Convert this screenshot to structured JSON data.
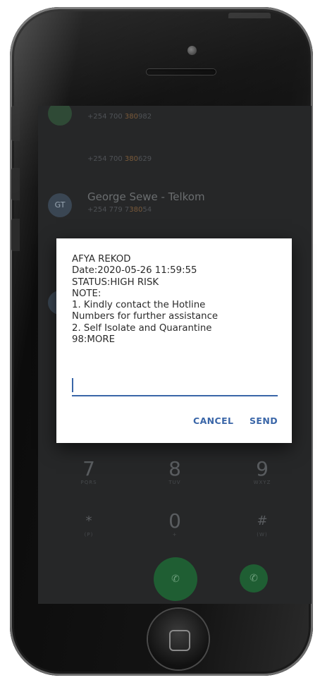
{
  "contacts": [
    {
      "initials": "",
      "name": "",
      "number_prefix": "+254 700 ",
      "number_highlight": "380",
      "number_suffix": "982"
    },
    {
      "initials": "",
      "name": "",
      "number_prefix": "+254 700 ",
      "number_highlight": "380",
      "number_suffix": "629"
    },
    {
      "initials": "GT",
      "name": "George Sewe - Telkom",
      "number_prefix": "+254 779 7",
      "number_highlight": "380",
      "number_suffix": "54"
    }
  ],
  "ussd_dialog": {
    "lines": [
      "AFYA REKOD",
      "Date:2020-05-26 11:59:55",
      "STATUS:HIGH RISK",
      "NOTE:",
      "1. Kindly contact the Hotline",
      "Numbers for further assistance",
      "2. Self Isolate and Quarantine",
      "98:MORE"
    ],
    "input_value": "",
    "cancel_label": "CANCEL",
    "send_label": "SEND"
  },
  "dialpad": {
    "keys": [
      {
        "digit": "7",
        "letters": "PQRS"
      },
      {
        "digit": "8",
        "letters": "TUV"
      },
      {
        "digit": "9",
        "letters": "WXYZ"
      },
      {
        "digit": "*",
        "letters": "(P)"
      },
      {
        "digit": "0",
        "letters": "+"
      },
      {
        "digit": "#",
        "letters": "(W)"
      }
    ]
  },
  "colors": {
    "accent": "#3a66a8",
    "screen_bg": "#262728",
    "call_green": "#1f5e33"
  }
}
